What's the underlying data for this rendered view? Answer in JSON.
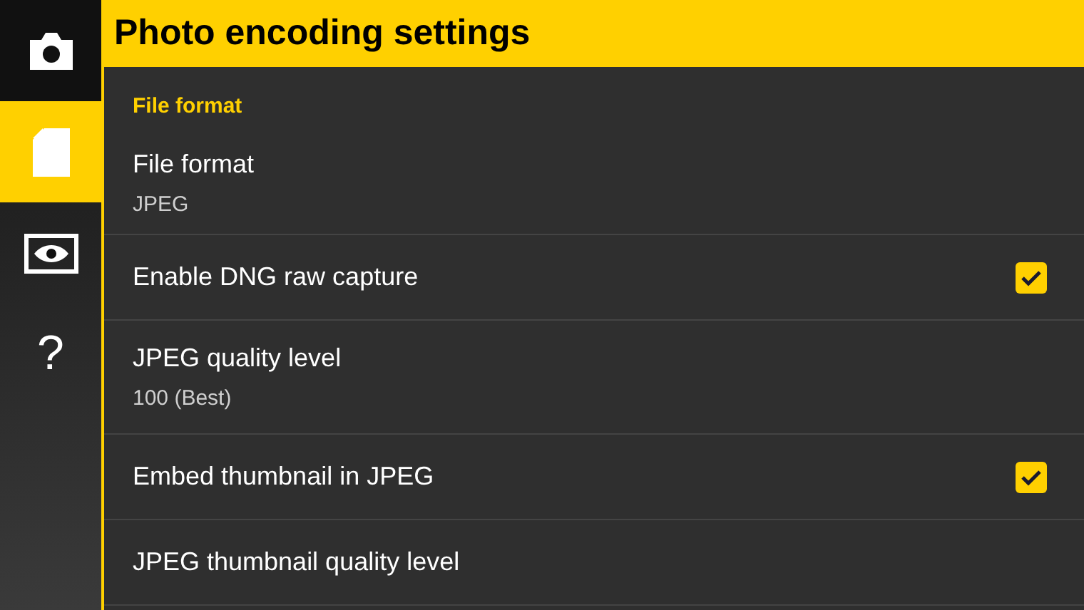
{
  "sidebar": {
    "items": [
      {
        "kind": "camera",
        "selected": false
      },
      {
        "kind": "file",
        "selected": true
      },
      {
        "kind": "eye",
        "selected": false
      },
      {
        "kind": "text",
        "label": "?",
        "selected": false
      }
    ]
  },
  "header": {
    "title": "Photo encoding settings"
  },
  "category": "File format",
  "settings": [
    {
      "kind": "value",
      "title": "File format",
      "value": "JPEG"
    },
    {
      "kind": "checkbox",
      "title": "Enable DNG raw capture",
      "checked": true
    },
    {
      "kind": "value",
      "title": "JPEG quality level",
      "value": "100 (Best)"
    },
    {
      "kind": "checkbox",
      "title": "Embed thumbnail in JPEG",
      "checked": true
    },
    {
      "kind": "plain",
      "title": "JPEG thumbnail quality level"
    }
  ]
}
